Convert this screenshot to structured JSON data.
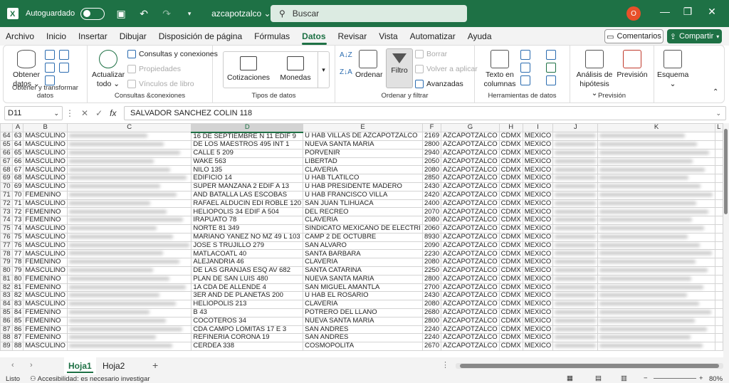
{
  "titlebar": {
    "autosave_label": "Autoguardado",
    "filename": "azcapotzalco",
    "search_placeholder": "Buscar",
    "avatar_initial": "O"
  },
  "menu": {
    "tabs": [
      "Archivo",
      "Inicio",
      "Insertar",
      "Dibujar",
      "Disposición de página",
      "Fórmulas",
      "Datos",
      "Revisar",
      "Vista",
      "Automatizar",
      "Ayuda"
    ],
    "active": "Datos",
    "comments": "Comentarios",
    "share": "Compartir"
  },
  "ribbon": {
    "get_data": {
      "button": "Obtener datos",
      "label": "Obtener y transformar datos"
    },
    "queries": {
      "refresh": "Actualizar todo",
      "connections": "Consultas y conexiones",
      "properties": "Propiedades",
      "links": "Vínculos de libro",
      "label": "Consultas &conexiones"
    },
    "types": {
      "stocks": "Cotizaciones",
      "currencies": "Monedas",
      "label": "Tipos de datos"
    },
    "sort": {
      "order": "Ordenar",
      "filter": "Filtro",
      "clear": "Borrar",
      "reapply": "Volver a aplicar",
      "advanced": "Avanzadas",
      "label": "Ordenar y filtrar"
    },
    "tools": {
      "text_columns": "Texto en columnas",
      "label": "Herramientas de datos"
    },
    "forecast": {
      "whatif": "Análisis de hipótesis",
      "forecast_sheet": "Previsión",
      "label": "Previsión"
    },
    "outline": {
      "button": "Esquema"
    }
  },
  "formula_bar": {
    "cell": "D11",
    "content": "SALVADOR SANCHEZ COLIN 118"
  },
  "columns": [
    "A",
    "B",
    "C",
    "D",
    "E",
    "F",
    "G",
    "H",
    "I",
    "J",
    "K",
    "L"
  ],
  "selected_column": "D",
  "rows": [
    {
      "r": "64",
      "a": "63",
      "b": "MASCULINO",
      "d": "16 DE SEPTIEMBRE N 11 EDIF 9",
      "e": "U HAB VILLAS DE AZCAPOTZALCO",
      "f": "2169",
      "g": "AZCAPOTZALCO",
      "h": "CDMX",
      "i": "MEXICO"
    },
    {
      "r": "65",
      "a": "64",
      "b": "MASCULINO",
      "d": "DE LOS MAESTROS 495 INT 1",
      "e": "NUEVA SANTA MARIA",
      "f": "2800",
      "g": "AZCAPOTZALCO",
      "h": "CDMX",
      "i": "MEXICO"
    },
    {
      "r": "66",
      "a": "65",
      "b": "MASCULINO",
      "d": "CALLE 5 209",
      "e": "PORVENIR",
      "f": "2940",
      "g": "AZCAPOTZALCO",
      "h": "CDMX",
      "i": "MEXICO"
    },
    {
      "r": "67",
      "a": "66",
      "b": "MASCULINO",
      "d": "WAKE 563",
      "e": "LIBERTAD",
      "f": "2050",
      "g": "AZCAPOTZALCO",
      "h": "CDMX",
      "i": "MEXICO"
    },
    {
      "r": "68",
      "a": "67",
      "b": "MASCULINO",
      "d": "NILO 135",
      "e": "CLAVERIA",
      "f": "2080",
      "g": "AZCAPOTZALCO",
      "h": "CDMX",
      "i": "MEXICO"
    },
    {
      "r": "69",
      "a": "68",
      "b": "MASCULINO",
      "d": "EDIFICIO 14",
      "e": "U HAB TLATILCO",
      "f": "2850",
      "g": "AZCAPOTZALCO",
      "h": "CDMX",
      "i": "MEXICO"
    },
    {
      "r": "70",
      "a": "69",
      "b": "MASCULINO",
      "d": "SUPER MANZANA 2 EDIF A 13",
      "e": "U HAB PRESIDENTE MADERO",
      "f": "2430",
      "g": "AZCAPOTZALCO",
      "h": "CDMX",
      "i": "MEXICO"
    },
    {
      "r": "71",
      "a": "70",
      "b": "FEMENINO",
      "d": "AND BATALLA LAS ESCOBAS",
      "e": "U HAB FRANCISCO VILLA",
      "f": "2420",
      "g": "AZCAPOTZALCO",
      "h": "CDMX",
      "i": "MEXICO"
    },
    {
      "r": "72",
      "a": "71",
      "b": "MASCULINO",
      "d": "RAFAEL ALDUCIN EDI ROBLE 120",
      "e": "SAN JUAN TLIHUACA",
      "f": "2400",
      "g": "AZCAPOTZALCO",
      "h": "CDMX",
      "i": "MEXICO"
    },
    {
      "r": "73",
      "a": "72",
      "b": "FEMENINO",
      "d": "HELIOPOLIS 34 EDIF A 504",
      "e": "DEL RECREO",
      "f": "2070",
      "g": "AZCAPOTZALCO",
      "h": "CDMX",
      "i": "MEXICO"
    },
    {
      "r": "74",
      "a": "73",
      "b": "FEMENINO",
      "d": "IRAPUATO 78",
      "e": "CLAVERIA",
      "f": "2080",
      "g": "AZCAPOTZALCO",
      "h": "CDMX",
      "i": "MEXICO"
    },
    {
      "r": "75",
      "a": "74",
      "b": "MASCULINO",
      "d": "NORTE 81 349",
      "e": "SINDICATO MEXICANO DE ELECTRI",
      "f": "2060",
      "g": "AZCAPOTZALCO",
      "h": "CDMX",
      "i": "MEXICO"
    },
    {
      "r": "76",
      "a": "75",
      "b": "MASCULINO",
      "d": "MARIANO YANEZ NO MZ 49 L 103",
      "e": "CAMP 2 DE OCTUBRE",
      "f": "8930",
      "g": "AZCAPOTZALCO",
      "h": "CDMX",
      "i": "MEXICO"
    },
    {
      "r": "77",
      "a": "76",
      "b": "MASCULINO",
      "d": "JOSE S TRUJILLO 279",
      "e": "SAN ALVARO",
      "f": "2090",
      "g": "AZCAPOTZALCO",
      "h": "CDMX",
      "i": "MEXICO"
    },
    {
      "r": "78",
      "a": "77",
      "b": "MASCULINO",
      "d": "MATLACOATL 40",
      "e": "SANTA BARBARA",
      "f": "2230",
      "g": "AZCAPOTZALCO",
      "h": "CDMX",
      "i": "MEXICO"
    },
    {
      "r": "79",
      "a": "78",
      "b": "FEMENINO",
      "d": "ALEJANDRIA 46",
      "e": "CLAVERIA",
      "f": "2080",
      "g": "AZCAPOTZALCO",
      "h": "CDMX",
      "i": "MEXICO"
    },
    {
      "r": "80",
      "a": "79",
      "b": "MASCULINO",
      "d": "DE LAS GRANJAS ESQ AV 682",
      "e": "SANTA CATARINA",
      "f": "2250",
      "g": "AZCAPOTZALCO",
      "h": "CDMX",
      "i": "MEXICO"
    },
    {
      "r": "81",
      "a": "80",
      "b": "FEMENINO",
      "d": "PLAN DE SAN LUIS 480",
      "e": "NUEVA SANTA MARIA",
      "f": "2800",
      "g": "AZCAPOTZALCO",
      "h": "CDMX",
      "i": "MEXICO"
    },
    {
      "r": "82",
      "a": "81",
      "b": "FEMENINO",
      "d": "1A CDA DE ALLENDE 4",
      "e": "SAN MIGUEL AMANTLA",
      "f": "2700",
      "g": "AZCAPOTZALCO",
      "h": "CDMX",
      "i": "MEXICO"
    },
    {
      "r": "83",
      "a": "82",
      "b": "MASCULINO",
      "d": "3ER AND DE PLANETAS 200",
      "e": "U HAB EL ROSARIO",
      "f": "2430",
      "g": "AZCAPOTZALCO",
      "h": "CDMX",
      "i": "MEXICO"
    },
    {
      "r": "84",
      "a": "83",
      "b": "MASCULINO",
      "d": "HELIOPOLIS 213",
      "e": "CLAVERIA",
      "f": "2080",
      "g": "AZCAPOTZALCO",
      "h": "CDMX",
      "i": "MEXICO"
    },
    {
      "r": "85",
      "a": "84",
      "b": "FEMENINO",
      "d": "B 43",
      "e": "POTRERO DEL LLANO",
      "f": "2680",
      "g": "AZCAPOTZALCO",
      "h": "CDMX",
      "i": "MEXICO"
    },
    {
      "r": "86",
      "a": "85",
      "b": "FEMENINO",
      "d": "COCOTEROS 34",
      "e": "NUEVA SANTA MARIA",
      "f": "2800",
      "g": "AZCAPOTZALCO",
      "h": "CDMX",
      "i": "MEXICO"
    },
    {
      "r": "87",
      "a": "86",
      "b": "FEMENINO",
      "d": "CDA CAMPO LOMITAS 17 E 3",
      "e": "SAN ANDRES",
      "f": "2240",
      "g": "AZCAPOTZALCO",
      "h": "CDMX",
      "i": "MEXICO"
    },
    {
      "r": "88",
      "a": "87",
      "b": "FEMENINO",
      "d": "REFINERIA CORONA 19",
      "e": "SAN ANDRES",
      "f": "2240",
      "g": "AZCAPOTZALCO",
      "h": "CDMX",
      "i": "MEXICO"
    },
    {
      "r": "89",
      "a": "88",
      "b": "MASCULINO",
      "d": "CERDEA 338",
      "e": "COSMOPOLITA",
      "f": "2670",
      "g": "AZCAPOTZALCO",
      "h": "CDMX",
      "i": "MEXICO"
    }
  ],
  "sheets": [
    "Hoja1",
    "Hoja2"
  ],
  "active_sheet": "Hoja1",
  "status": {
    "ready": "Listo",
    "accessibility": "Accesibilidad: es necesario investigar",
    "zoom": "80%"
  }
}
